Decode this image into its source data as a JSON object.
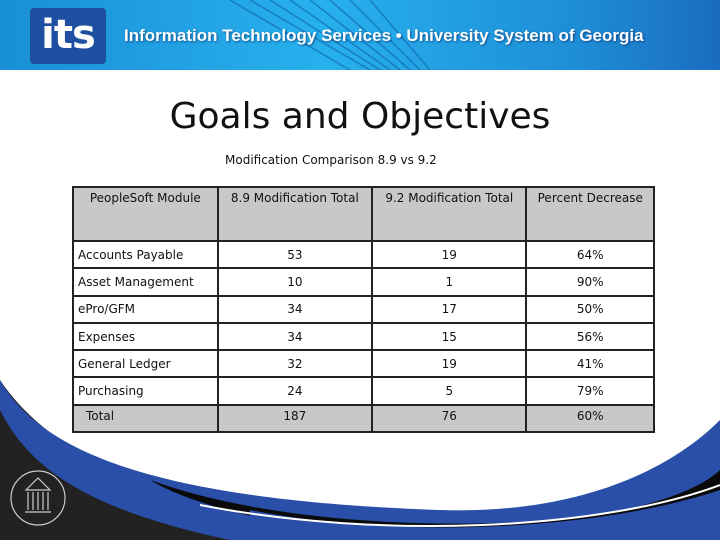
{
  "banner": {
    "logo": "its",
    "tagline": "Information Technology Services  •  University System of Georgia"
  },
  "title": "Goals and Objectives",
  "subtitle": "Modification Comparison 8.9 vs 9.2",
  "table": {
    "headers": [
      "PeopleSoft Module",
      "8.9 Modification Total",
      "9.2 Modification Total",
      "Percent Decrease"
    ],
    "rows": [
      [
        "Accounts Payable",
        "53",
        "19",
        "64%"
      ],
      [
        "Asset Management",
        "10",
        "1",
        "90%"
      ],
      [
        "ePro/GFM",
        "34",
        "17",
        "50%"
      ],
      [
        "Expenses",
        "34",
        "15",
        "56%"
      ],
      [
        "General Ledger",
        "32",
        "19",
        "41%"
      ],
      [
        "Purchasing",
        "24",
        "5",
        "79%"
      ]
    ],
    "total": [
      "Total",
      "187",
      "76",
      "60%"
    ]
  },
  "footer": {
    "seal": "Board of Regents of the University System of Georgia"
  },
  "colors": {
    "banner": "#27b0ee",
    "logo_bg": "#1f4fa0",
    "swoosh_blue": "#2a4fa8",
    "swoosh_dark": "#1e1e1e",
    "header_fill": "#c8c8c8"
  }
}
